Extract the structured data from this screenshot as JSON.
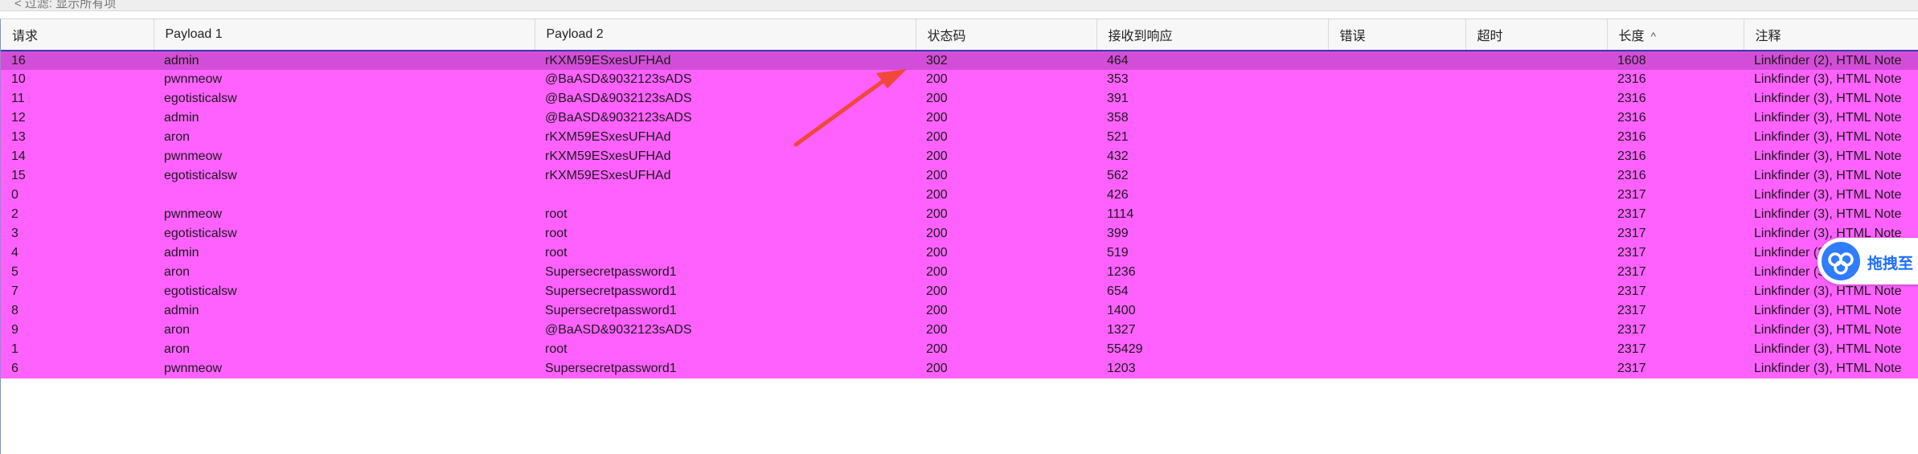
{
  "top_bar": {
    "breadcrumb": "< 过滤: 显示所有项"
  },
  "table": {
    "headers": [
      "请求",
      "Payload 1",
      "Payload 2",
      "状态码",
      "接收到响应",
      "错误",
      "超时",
      "长度",
      "注释"
    ],
    "sort_indicator": "^",
    "rows": [
      [
        "16",
        "admin",
        "rKXM59ESxesUFHAd",
        "302",
        "464",
        "",
        "",
        "1608",
        "Linkfinder (2), HTML Note"
      ],
      [
        "10",
        "pwnmeow",
        "@BaASD&9032123sADS",
        "200",
        "353",
        "",
        "",
        "2316",
        "Linkfinder (3), HTML Note"
      ],
      [
        "11",
        "egotisticalsw",
        "@BaASD&9032123sADS",
        "200",
        "391",
        "",
        "",
        "2316",
        "Linkfinder (3), HTML Note"
      ],
      [
        "12",
        "admin",
        "@BaASD&9032123sADS",
        "200",
        "358",
        "",
        "",
        "2316",
        "Linkfinder (3), HTML Note"
      ],
      [
        "13",
        "aron",
        "rKXM59ESxesUFHAd",
        "200",
        "521",
        "",
        "",
        "2316",
        "Linkfinder (3), HTML Note"
      ],
      [
        "14",
        "pwnmeow",
        "rKXM59ESxesUFHAd",
        "200",
        "432",
        "",
        "",
        "2316",
        "Linkfinder (3), HTML Note"
      ],
      [
        "15",
        "egotisticalsw",
        "rKXM59ESxesUFHAd",
        "200",
        "562",
        "",
        "",
        "2316",
        "Linkfinder (3), HTML Note"
      ],
      [
        "0",
        "",
        "",
        "200",
        "426",
        "",
        "",
        "2317",
        "Linkfinder (3), HTML Note"
      ],
      [
        "2",
        "pwnmeow",
        "root",
        "200",
        "1114",
        "",
        "",
        "2317",
        "Linkfinder (3), HTML Note"
      ],
      [
        "3",
        "egotisticalsw",
        "root",
        "200",
        "399",
        "",
        "",
        "2317",
        "Linkfinder (3), HTML Note"
      ],
      [
        "4",
        "admin",
        "root",
        "200",
        "519",
        "",
        "",
        "2317",
        "Linkfinder (3), HTML Note"
      ],
      [
        "5",
        "aron",
        "Supersecretpassword1",
        "200",
        "1236",
        "",
        "",
        "2317",
        "Linkfinder (3), HTML Note"
      ],
      [
        "7",
        "egotisticalsw",
        "Supersecretpassword1",
        "200",
        "654",
        "",
        "",
        "2317",
        "Linkfinder (3), HTML Note"
      ],
      [
        "8",
        "admin",
        "Supersecretpassword1",
        "200",
        "1400",
        "",
        "",
        "2317",
        "Linkfinder (3), HTML Note"
      ],
      [
        "9",
        "aron",
        "@BaASD&9032123sADS",
        "200",
        "1327",
        "",
        "",
        "2317",
        "Linkfinder (3), HTML Note"
      ],
      [
        "1",
        "aron",
        "root",
        "200",
        "55429",
        "",
        "",
        "2317",
        "Linkfinder (3), HTML Note"
      ],
      [
        "6",
        "pwnmeow",
        "Supersecretpassword1",
        "200",
        "1203",
        "",
        "",
        "2317",
        "Linkfinder (3), HTML Note"
      ]
    ],
    "selected_row_index": 0
  },
  "floating_button": {
    "label": "拖拽至",
    "icon": "cloud-icon"
  },
  "colors": {
    "row_highlight": "#ff61ff",
    "row_selected": "#d34ed8",
    "annotation_arrow": "#f0483a",
    "floating_button_blue": "#2f7cff"
  }
}
